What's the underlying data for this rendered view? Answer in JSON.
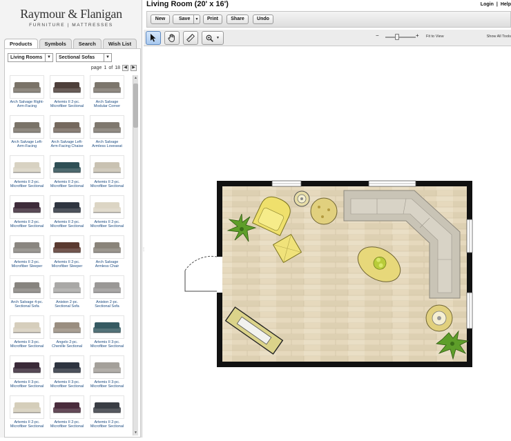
{
  "brand": {
    "name": "Raymour & Flanigan",
    "subtitle": "FURNITURE | MATTRESSES"
  },
  "tabs": [
    {
      "label": "Products"
    },
    {
      "label": "Symbols"
    },
    {
      "label": "Search"
    },
    {
      "label": "Wish List"
    }
  ],
  "filters": {
    "room": "Living Rooms",
    "category": "Sectional Sofas"
  },
  "pager": {
    "prefix": "page",
    "current": "1",
    "of": "of",
    "total": "18"
  },
  "products": [
    {
      "l1": "Arch Salvage Right-",
      "l2": "Arm-Facing",
      "color": "#7a7368"
    },
    {
      "l1": "Artemis II 2-pc.",
      "l2": "Microfiber Sectional",
      "color": "#4d3f3a"
    },
    {
      "l1": "Arch Salvage",
      "l2": "Modular Corner",
      "color": "#7c766c"
    },
    {
      "l1": "Arch Salvage Left-",
      "l2": "Arm-Facing",
      "color": "#7a7368"
    },
    {
      "l1": "Arch Salvage Left-",
      "l2": "Arm-Facing Chaise",
      "color": "#75695e"
    },
    {
      "l1": "Arch Salvage",
      "l2": "Armless Loveseat",
      "color": "#7f786e"
    },
    {
      "l1": "Artemis II 2-pc.",
      "l2": "Microfiber Sectional",
      "color": "#d8d2c2"
    },
    {
      "l1": "Artemis II 2-pc.",
      "l2": "Microfiber Sectional",
      "color": "#2f4f55"
    },
    {
      "l1": "Artemis II 2-pc.",
      "l2": "Microfiber Sectional",
      "color": "#c9c2b2"
    },
    {
      "l1": "Artemis II 2-pc.",
      "l2": "Microfiber Sectional",
      "color": "#3e2c3a"
    },
    {
      "l1": "Artemis II 2-pc.",
      "l2": "Microfiber Sectional",
      "color": "#2f3540"
    },
    {
      "l1": "Artemis II 2-pc.",
      "l2": "Microfiber Sectional",
      "color": "#dcd5c4"
    },
    {
      "l1": "Artemis II 2-pc.",
      "l2": "Microfiber Sleeper",
      "color": "#8a8680"
    },
    {
      "l1": "Artemis II 2-pc.",
      "l2": "Microfiber Sleeper",
      "color": "#5a3a30"
    },
    {
      "l1": "Arch Salvage",
      "l2": "Armless Chair",
      "color": "#8a847a"
    },
    {
      "l1": "Arch Salvage 4-pc.",
      "l2": "Sectional Sofa",
      "color": "#87847f"
    },
    {
      "l1": "Aniston 2-pc.",
      "l2": "Sectional Sofa",
      "color": "#a9a8a6"
    },
    {
      "l1": "Aniston 2-pc.",
      "l2": "Sectional Sofa",
      "color": "#9a9896"
    },
    {
      "l1": "Artemis II 3-pc.",
      "l2": "Microfiber Sectional",
      "color": "#d6cebc"
    },
    {
      "l1": "Angelo 2-pc.",
      "l2": "Chenille Sectional",
      "color": "#9a8e80"
    },
    {
      "l1": "Artemis II 3-pc.",
      "l2": "Microfiber Sectional",
      "color": "#365a62"
    },
    {
      "l1": "Artemis II 3-pc.",
      "l2": "Microfiber Sectional",
      "color": "#3a2a38"
    },
    {
      "l1": "Artemis II 3-pc.",
      "l2": "Microfiber Sectional",
      "color": "#2e3440"
    },
    {
      "l1": "Artemis II 3-pc.",
      "l2": "Microfiber Sectional",
      "color": "#a4a09a"
    },
    {
      "l1": "Artemis II 2-pc.",
      "l2": "Microfiber Sectional",
      "color": "#d5ceba"
    },
    {
      "l1": "Artemis II 2-pc.",
      "l2": "Microfiber Sectional",
      "color": "#4a2c3c"
    },
    {
      "l1": "Artemis II 2-pc.",
      "l2": "Microfiber Sectional",
      "color": "#3a3d44"
    }
  ],
  "title": "Living Room (20' x 16')",
  "toplinks": {
    "login": "Login",
    "sep": "|",
    "help": "Help"
  },
  "toolbar": {
    "new": "New",
    "save": "Save",
    "print": "Print",
    "share": "Share",
    "undo": "Undo"
  },
  "zoom": {
    "minus": "−",
    "plus": "+",
    "fit": "Fit to View",
    "show_all": "Show All Tools"
  },
  "icons": {
    "select": "pointer-icon",
    "pan": "hand-icon",
    "measure": "ruler-icon",
    "zoom": "magnifier-icon"
  },
  "colors": {
    "floor": "#e6d9bd",
    "wall": "#111111",
    "sofa": "#c9c4b6",
    "chair": "#f2e87a",
    "accent": "#5a87c0",
    "link": "#1a4a80"
  }
}
